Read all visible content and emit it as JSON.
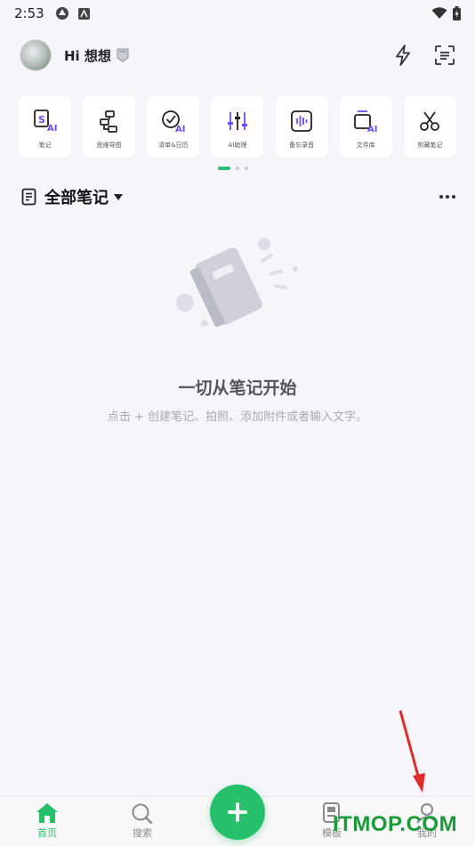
{
  "status_bar": {
    "time": "2:53"
  },
  "header": {
    "greeting": "Hi 想想"
  },
  "tools": [
    {
      "label": "笔记",
      "icon": "note-ai-icon"
    },
    {
      "label": "思维导图",
      "icon": "mindmap-icon"
    },
    {
      "label": "清单&日历",
      "icon": "checklist-ai-icon"
    },
    {
      "label": "AI助理",
      "icon": "ai-assistant-icon"
    },
    {
      "label": "备忘录音",
      "icon": "voice-memo-icon"
    },
    {
      "label": "文件库",
      "icon": "file-library-ai-icon"
    },
    {
      "label": "剪藏笔记",
      "icon": "clip-note-icon"
    }
  ],
  "section": {
    "title": "全部笔记"
  },
  "empty_state": {
    "title": "一切从笔记开始",
    "subtitle": "点击 + 创建笔记。拍照、添加附件或者输入文字。"
  },
  "bottom_nav": {
    "home": "首页",
    "search": "搜索",
    "templates": "模板",
    "mine": "我的"
  },
  "watermark": "ITMOP.COM",
  "colors": {
    "accent": "#27c06a",
    "ai_purple": "#6c4cf2",
    "background": "#f6f6fa"
  }
}
